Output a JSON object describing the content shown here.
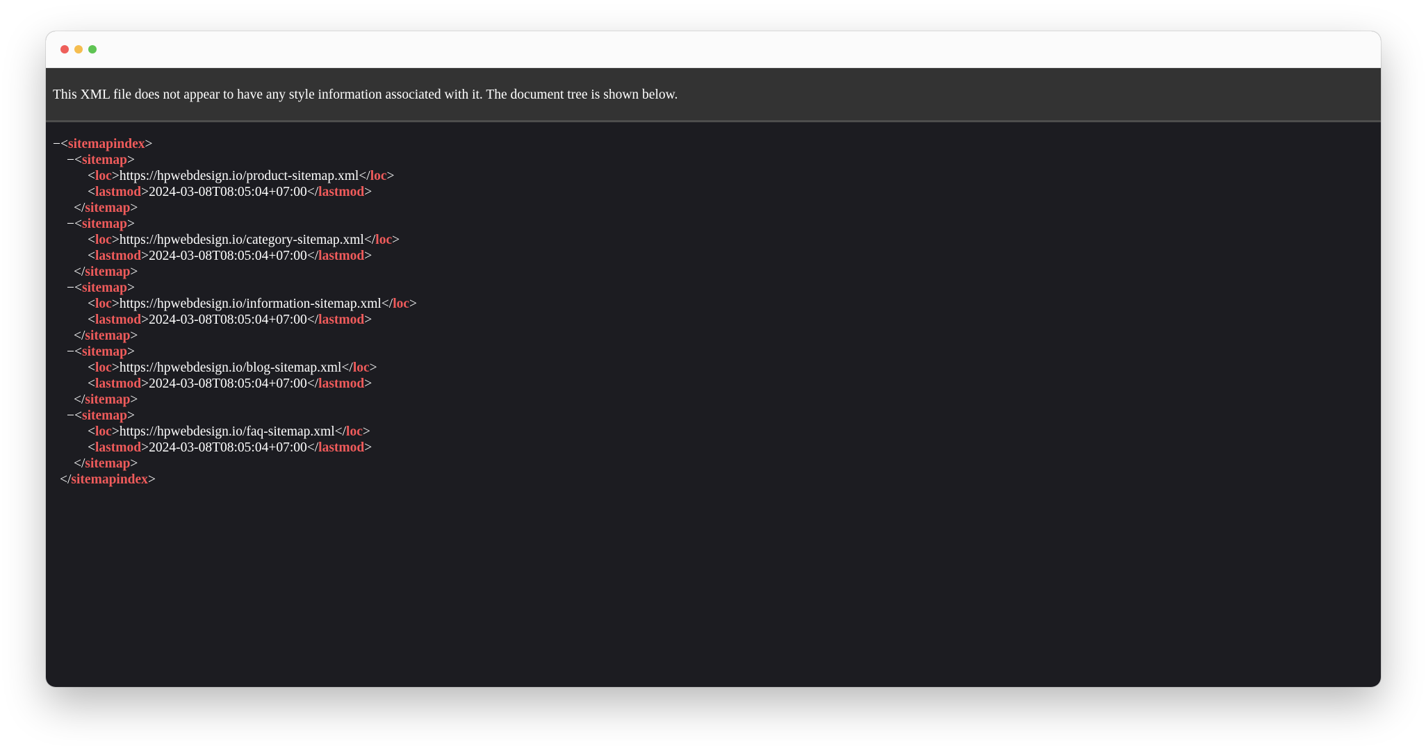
{
  "window": {
    "controls": [
      "close",
      "minimize",
      "zoom"
    ]
  },
  "info_bar": {
    "text": "This XML file does not appear to have any style information associated with it. The document tree is shown below."
  },
  "xml": {
    "root_tag": "sitemapindex",
    "fold_marker": "−",
    "sitemaps": [
      {
        "tag": "sitemap",
        "loc_tag": "loc",
        "loc": "https://hpwebdesign.io/product-sitemap.xml",
        "lastmod_tag": "lastmod",
        "lastmod": "2024-03-08T08:05:04+07:00"
      },
      {
        "tag": "sitemap",
        "loc_tag": "loc",
        "loc": "https://hpwebdesign.io/category-sitemap.xml",
        "lastmod_tag": "lastmod",
        "lastmod": "2024-03-08T08:05:04+07:00"
      },
      {
        "tag": "sitemap",
        "loc_tag": "loc",
        "loc": "https://hpwebdesign.io/information-sitemap.xml",
        "lastmod_tag": "lastmod",
        "lastmod": "2024-03-08T08:05:04+07:00"
      },
      {
        "tag": "sitemap",
        "loc_tag": "loc",
        "loc": "https://hpwebdesign.io/blog-sitemap.xml",
        "lastmod_tag": "lastmod",
        "lastmod": "2024-03-08T08:05:04+07:00"
      },
      {
        "tag": "sitemap",
        "loc_tag": "loc",
        "loc": "https://hpwebdesign.io/faq-sitemap.xml",
        "lastmod_tag": "lastmod",
        "lastmod": "2024-03-08T08:05:04+07:00"
      }
    ]
  },
  "colors": {
    "tag": "#ef5b5b",
    "text": "#ffffff",
    "background": "#1c1c21",
    "info_bar": "#333333"
  }
}
